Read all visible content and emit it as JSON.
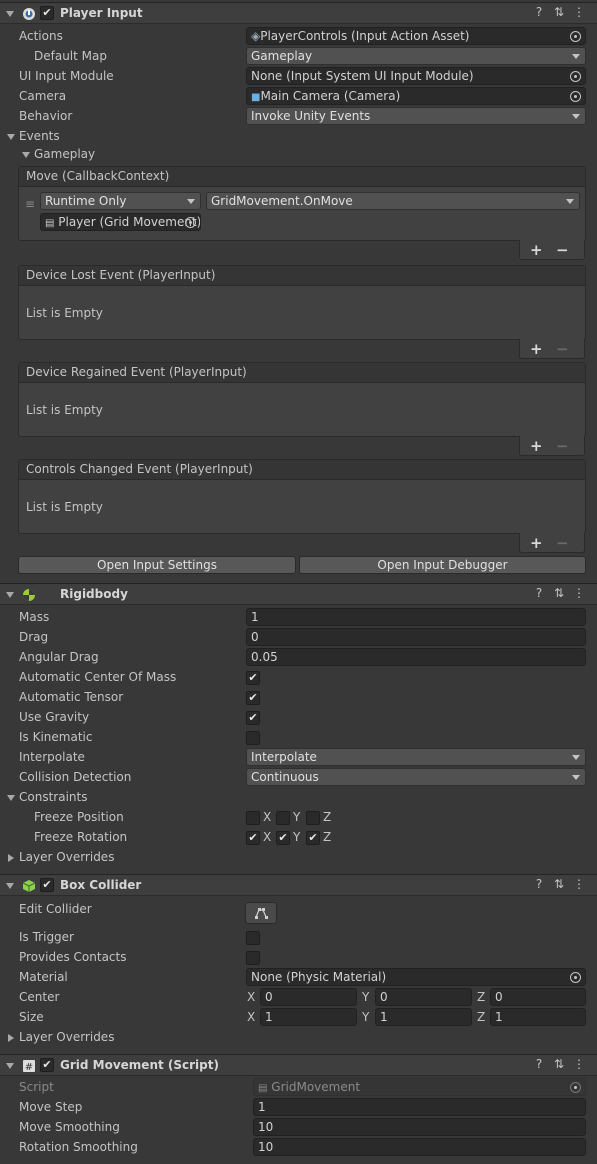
{
  "player_input": {
    "title": "Player Input",
    "enabled": true,
    "actions": {
      "label": "Actions",
      "value": "PlayerControls (Input Action Asset)"
    },
    "default_map": {
      "label": "Default Map",
      "value": "Gameplay"
    },
    "ui_input_module": {
      "label": "UI Input Module",
      "value": "None (Input System UI Input Module)"
    },
    "camera": {
      "label": "Camera",
      "value": "Main Camera (Camera)"
    },
    "behavior": {
      "label": "Behavior",
      "value": "Invoke Unity Events"
    },
    "events_label": "Events",
    "gameplay_label": "Gameplay",
    "move_event": {
      "title": "Move (CallbackContext)",
      "runtime": "Runtime Only",
      "function": "GridMovement.OnMove",
      "target": "Player (Grid Movement)"
    },
    "device_lost": {
      "title": "Device Lost Event (PlayerInput)",
      "empty": "List is Empty"
    },
    "device_regained": {
      "title": "Device Regained Event (PlayerInput)",
      "empty": "List is Empty"
    },
    "controls_changed": {
      "title": "Controls Changed Event (PlayerInput)",
      "empty": "List is Empty"
    },
    "open_settings": "Open Input Settings",
    "open_debugger": "Open Input Debugger"
  },
  "rigidbody": {
    "title": "Rigidbody",
    "mass": {
      "label": "Mass",
      "value": "1"
    },
    "drag": {
      "label": "Drag",
      "value": "0"
    },
    "angular_drag": {
      "label": "Angular Drag",
      "value": "0.05"
    },
    "auto_center": {
      "label": "Automatic Center Of Mass",
      "checked": true
    },
    "auto_tensor": {
      "label": "Automatic Tensor",
      "checked": true
    },
    "use_gravity": {
      "label": "Use Gravity",
      "checked": true
    },
    "is_kinematic": {
      "label": "Is Kinematic",
      "checked": false
    },
    "interpolate": {
      "label": "Interpolate",
      "value": "Interpolate"
    },
    "collision_detection": {
      "label": "Collision Detection",
      "value": "Continuous"
    },
    "constraints_label": "Constraints",
    "freeze_position": {
      "label": "Freeze Position",
      "x": false,
      "y": false,
      "z": false
    },
    "freeze_rotation": {
      "label": "Freeze Rotation",
      "x": true,
      "y": true,
      "z": true
    },
    "layer_overrides": "Layer Overrides"
  },
  "box_collider": {
    "title": "Box Collider",
    "enabled": true,
    "edit_collider": "Edit Collider",
    "is_trigger": {
      "label": "Is Trigger",
      "checked": false
    },
    "provides_contacts": {
      "label": "Provides Contacts",
      "checked": false
    },
    "material": {
      "label": "Material",
      "value": "None (Physic Material)"
    },
    "center": {
      "label": "Center",
      "x": "0",
      "y": "0",
      "z": "0"
    },
    "size": {
      "label": "Size",
      "x": "1",
      "y": "1",
      "z": "1"
    },
    "layer_overrides": "Layer Overrides"
  },
  "grid_movement": {
    "title": "Grid Movement (Script)",
    "enabled": true,
    "script": {
      "label": "Script",
      "value": "GridMovement"
    },
    "move_step": {
      "label": "Move Step",
      "value": "1"
    },
    "move_smoothing": {
      "label": "Move Smoothing",
      "value": "10"
    },
    "rotation_smoothing": {
      "label": "Rotation Smoothing",
      "value": "10"
    }
  },
  "axis_labels": {
    "x": "X",
    "y": "Y",
    "z": "Z"
  },
  "check_glyph": "✔",
  "plus": "+",
  "minus": "−",
  "header_buttons": {
    "help": "?",
    "presets": "⇅",
    "menu": "⋮"
  }
}
